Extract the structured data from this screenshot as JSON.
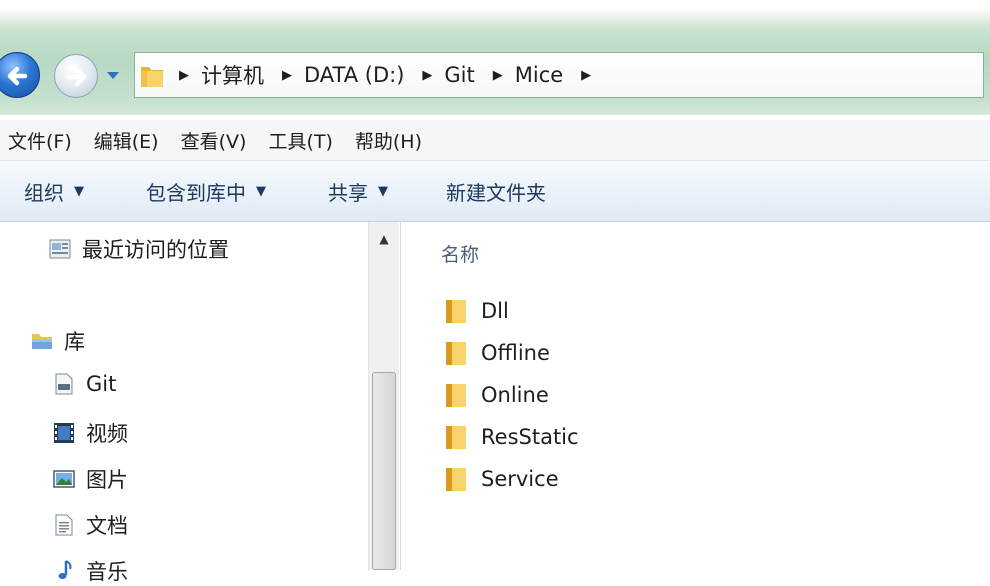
{
  "address_bar": {
    "breadcrumbs": [
      "计算机",
      "DATA (D:)",
      "Git",
      "Mice"
    ]
  },
  "menu": {
    "items": [
      "文件(F)",
      "编辑(E)",
      "查看(V)",
      "工具(T)",
      "帮助(H)"
    ]
  },
  "command_bar": {
    "organize": "组织",
    "include_in_library": "包含到库中",
    "share": "共享",
    "new_folder": "新建文件夹"
  },
  "nav_pane": {
    "recent_places": "最近访问的位置",
    "libraries": "库",
    "library_items": [
      "Git",
      "视频",
      "图片",
      "文档",
      "音乐"
    ]
  },
  "content": {
    "column_name": "名称",
    "items": [
      "Dll",
      "Offline",
      "Online",
      "ResStatic",
      "Service"
    ]
  },
  "colors": {
    "address_band": "#c5e0cf",
    "command_text": "#1c3a60",
    "folder_yellow": "#f0c24a"
  }
}
